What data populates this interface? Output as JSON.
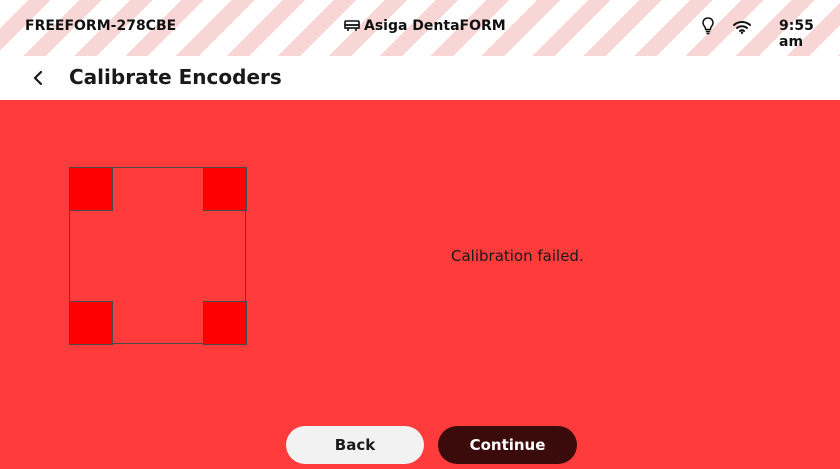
{
  "status_bar": {
    "device_name": "FREEFORM-278CBE",
    "printer_name": "Asiga DentaFORM",
    "time": "9:55 am",
    "icons": [
      "printer-icon",
      "lightbulb-icon",
      "wifi-icon"
    ]
  },
  "header": {
    "back_icon": "chevron-left-icon",
    "title": "Calibrate Encoders"
  },
  "main": {
    "message": "Calibration failed.",
    "plate": {
      "corners": [
        "top-left",
        "top-right",
        "bottom-left",
        "bottom-right"
      ]
    }
  },
  "actions": {
    "back_label": "Back",
    "continue_label": "Continue"
  },
  "colors": {
    "background": "#ff3b3b",
    "corner_fill": "#ff0000",
    "continue_button": "#3b0a0a",
    "back_button": "#f2f2f2"
  }
}
